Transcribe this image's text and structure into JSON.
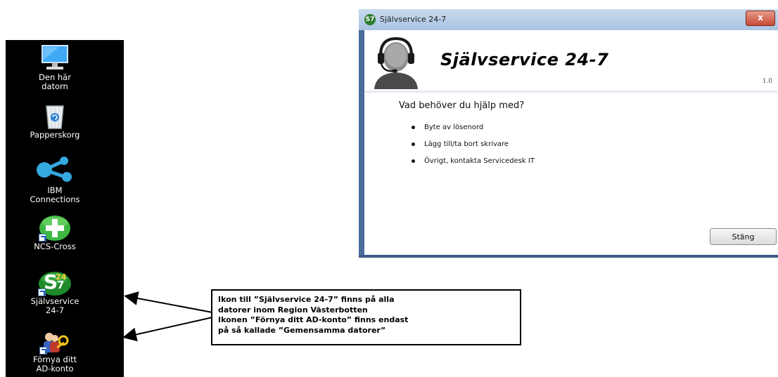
{
  "desktop": {
    "icons": [
      {
        "label": "Den här\ndatorn",
        "icon": "computer-icon"
      },
      {
        "label": "Papperskorg",
        "icon": "recycle-bin-icon"
      },
      {
        "label": "IBM\nConnections",
        "icon": "ibm-connections-icon"
      },
      {
        "label": "NCS-Cross",
        "icon": "ncs-cross-icon"
      },
      {
        "label": "Självservice\n24-7",
        "icon": "sjalvservice-icon"
      },
      {
        "label": "Förnya ditt\nAD-konto",
        "icon": "renew-ad-account-icon"
      }
    ],
    "selfservice_badge": {
      "top": "24",
      "main": "S",
      "bottom": "7"
    }
  },
  "dialog": {
    "window_title": "Självservice 24-7",
    "app_icon_text": "S7",
    "close_glyph": "x",
    "heading": "Självservice 24-7",
    "version": "1.0",
    "question": "Vad behöver du hjälp med?",
    "options": [
      "Byte av lösenord",
      "Lägg till/ta bort skrivare",
      "Övrigt, kontakta Servicedesk IT"
    ],
    "close_button_label": "Stäng"
  },
  "annotation": {
    "lines": [
      "Ikon till ”Självservice 24-7” finns på alla",
      "datorer inom Region Västerbotten",
      "Ikonen ”Förnya ditt AD-konto” finns endast",
      "på så kallade ”Gemensamma datorer”"
    ]
  },
  "colors": {
    "desktop_bg": "#000000",
    "window_frame": "#4a6d9a",
    "close_red": "#c64a34",
    "badge_green": "#1e8a2a"
  }
}
